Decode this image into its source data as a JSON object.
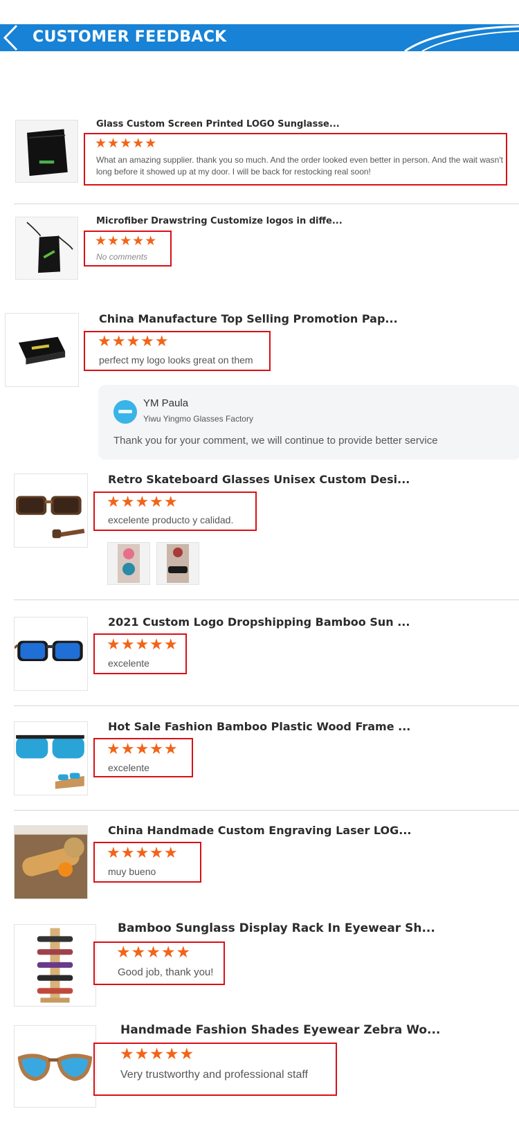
{
  "banner": {
    "title": "CUSTOMER FEEDBACK"
  },
  "colors": {
    "banner": "#1782d6",
    "star": "#f26418",
    "highlight": "#d90f16"
  },
  "reviews": [
    {
      "title": "Glass Custom Screen Printed LOGO Sunglasse...",
      "stars": "★★★★★",
      "rating": 5,
      "comment": "What an amazing supplier. thank you so much. And the order looked even better in person. And the wait wasn't long before it showed up at my door. I will be back for restocking real soon!",
      "image": "black-pouch"
    },
    {
      "title": "Microfiber Drawstring Customize logos in diffe...",
      "stars": "★★★★★",
      "rating": 5,
      "comment": "No comments",
      "image": "drawstring-bag"
    },
    {
      "title": "China Manufacture Top Selling Promotion Pap...",
      "stars": "★★★★★",
      "rating": 5,
      "comment": "perfect my logo looks great on them",
      "image": "black-box"
    },
    {
      "title": "Retro Skateboard Glasses Unisex Custom Desi...",
      "stars": "★★★★★",
      "rating": 5,
      "comment": "excelente producto y calidad.",
      "image": "wood-sunglasses"
    },
    {
      "title": "2021 Custom Logo Dropshipping Bamboo Sun ...",
      "stars": "★★★★★",
      "rating": 5,
      "comment": "excelente",
      "image": "blue-sunglasses"
    },
    {
      "title": "Hot Sale Fashion Bamboo Plastic Wood Frame ...",
      "stars": "★★★★★",
      "rating": 5,
      "comment": "excelente",
      "image": "teal-sunglasses"
    },
    {
      "title": "China Handmade Custom Engraving Laser LOG...",
      "stars": "★★★★★",
      "rating": 5,
      "comment": "muy bueno",
      "image": "bamboo-tube"
    },
    {
      "title": "Bamboo Sunglass Display Rack In Eyewear Sh...",
      "stars": "★★★★★",
      "rating": 5,
      "comment": "Good job, thank you!",
      "image": "display-rack"
    },
    {
      "title": "Handmade Fashion Shades Eyewear Zebra Wo...",
      "stars": "★★★★★",
      "rating": 5,
      "comment": "Very trustworthy and professional staff",
      "image": "zebra-sunglasses"
    }
  ],
  "seller_reply": {
    "name": "YM Paula",
    "company": "Yiwu Yingmo Glasses Factory",
    "text": "Thank you for your comment, we will continue to provide better service"
  }
}
